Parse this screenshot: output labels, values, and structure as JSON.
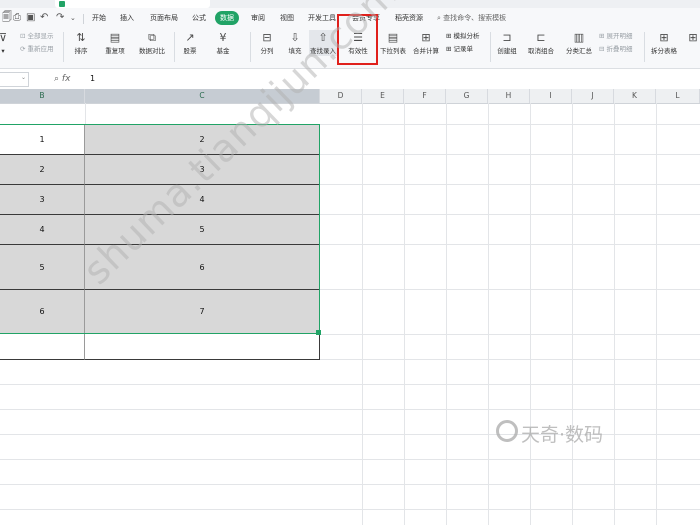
{
  "menu": {
    "items": [
      "开始",
      "插入",
      "页面布局",
      "公式",
      "数据",
      "审阅",
      "视图",
      "开发工具",
      "会员专享",
      "稻壳资源"
    ],
    "active": "数据",
    "search": "查找命令、搜索模板"
  },
  "ribbon": {
    "filter_sub1": "全部显示",
    "filter_sub2": "重新应用",
    "sort": "排序",
    "duplicates": "重复项",
    "compare": "数据对比",
    "stock": "股票",
    "fund": "基金",
    "split": "分列",
    "fill": "填充",
    "lookup": "查找录入",
    "validity": "有效性",
    "dropdown": "下拉列表",
    "consolidate": "合并计算",
    "simulate": "模拟分析",
    "record": "记录单",
    "create_group": "创建组",
    "ungroup": "取消组合",
    "subtotal": "分类汇总",
    "expand_detail": "展开明细",
    "collapse_detail": "折叠明细",
    "split_table": "拆分表格"
  },
  "formula_bar": {
    "fx": "fx",
    "value": "1"
  },
  "columns": [
    "B",
    "C",
    "D",
    "E",
    "F",
    "G",
    "H",
    "I",
    "J",
    "K",
    "L"
  ],
  "table": {
    "rows": [
      {
        "b": "1",
        "c": "2"
      },
      {
        "b": "2",
        "c": "3"
      },
      {
        "b": "3",
        "c": "4"
      },
      {
        "b": "4",
        "c": "5"
      },
      {
        "b": "5",
        "c": "6"
      },
      {
        "b": "6",
        "c": "7"
      }
    ]
  },
  "watermark": {
    "diagonal": "shuma.tianqijun.com",
    "logo_text": "天奇·数码"
  },
  "colors": {
    "accent": "#21a366",
    "highlight": "#e0201c",
    "selection_fill": "#d8d8d8"
  }
}
